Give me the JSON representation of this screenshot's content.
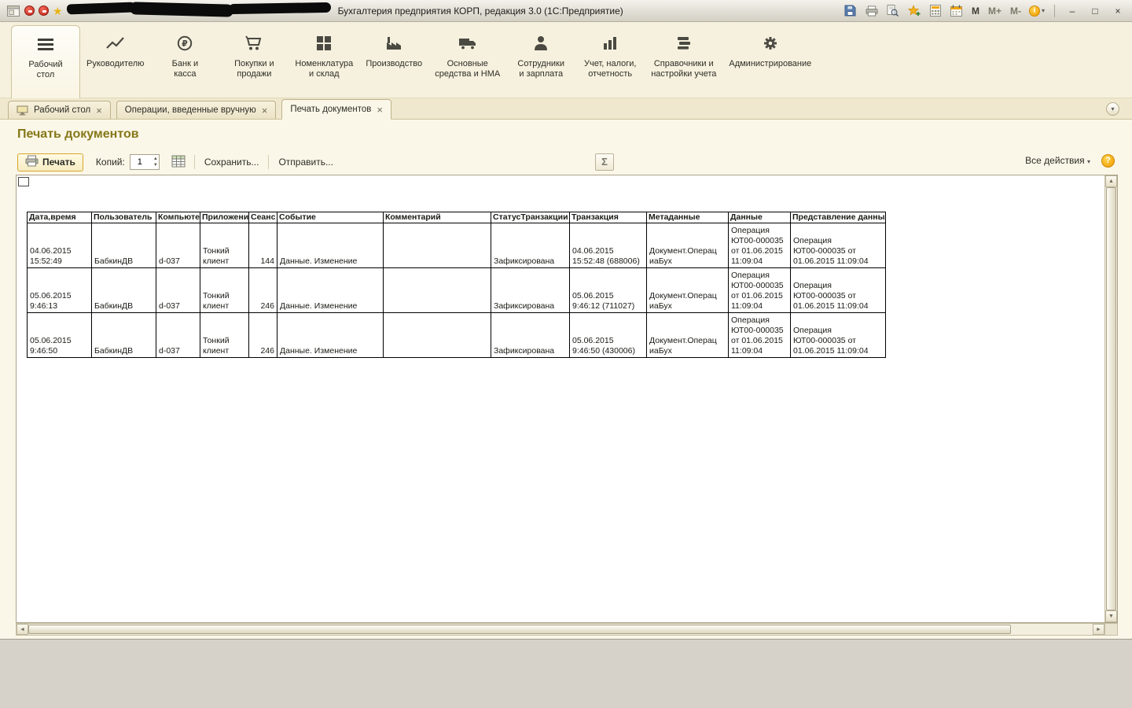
{
  "window": {
    "title": "Бухгалтерия предприятия КОРП, редакция 3.0  (1С:Предприятие)",
    "memory_buttons": [
      "M",
      "M+",
      "M-"
    ]
  },
  "ui": {
    "close_glyph": "×",
    "dropdown_glyph": "▾",
    "star_glyph": "★",
    "info_glyph": "i",
    "minimize_glyph": "–",
    "maximize_glyph": "□",
    "spin_up": "▲",
    "spin_down": "▼",
    "scroll_up": "▲",
    "scroll_down": "▼",
    "scroll_left": "◄",
    "scroll_right": "►"
  },
  "sections": [
    {
      "label": "Рабочий\nстол",
      "icon": "menu-icon",
      "active": true
    },
    {
      "label": "Руководителю",
      "icon": "trend-icon",
      "active": false
    },
    {
      "label": "Банк и\nкасса",
      "icon": "coin-icon",
      "active": false
    },
    {
      "label": "Покупки и\nпродажи",
      "icon": "cart-icon",
      "active": false
    },
    {
      "label": "Номенклатура\nи склад",
      "icon": "grid-icon",
      "active": false
    },
    {
      "label": "Производство",
      "icon": "factory-icon",
      "active": false
    },
    {
      "label": "Основные\nсредства и НМА",
      "icon": "truck-icon",
      "active": false
    },
    {
      "label": "Сотрудники\nи зарплата",
      "icon": "person-icon",
      "active": false
    },
    {
      "label": "Учет, налоги,\nотчетность",
      "icon": "barchart-icon",
      "active": false
    },
    {
      "label": "Справочники и\nнастройки учета",
      "icon": "books-icon",
      "active": false
    },
    {
      "label": "Администрирование",
      "icon": "gear-icon",
      "active": false
    }
  ],
  "tabs": [
    {
      "label": "Рабочий стол",
      "active": false
    },
    {
      "label": "Операции, введенные вручную",
      "active": false
    },
    {
      "label": "Печать документов",
      "active": true
    }
  ],
  "page": {
    "title": "Печать документов",
    "toolbar": {
      "print_label": "Печать",
      "copies_label": "Копий:",
      "copies_value": "1",
      "save_label": "Сохранить...",
      "send_label": "Отправить...",
      "sigma_label": "Σ",
      "all_actions_label": "Все действия",
      "help_label": "?"
    },
    "table": {
      "columns": [
        "Дата,время",
        "Пользователь",
        "Компьютер",
        "Приложение",
        "Сеанс",
        "Событие",
        "Комментарий",
        "СтатусТранзакции",
        "Транзакция",
        "Метаданные",
        "Данные",
        "Представление данных"
      ],
      "rows": [
        {
          "cells": [
            "04.06.2015\n15:52:49",
            "БабкинДВ",
            "d-037",
            "Тонкий\nклиент",
            "144",
            "Данные. Изменение",
            "",
            "Зафиксирована",
            "04.06.2015\n15:52:48 (688006)",
            "Документ.Операц\nиаБух",
            "Операция\nЮТ00-000035\nот 01.06.2015\n11:09:04",
            "Операция\nЮТ00-000035 от\n01.06.2015 11:09:04"
          ]
        },
        {
          "cells": [
            "05.06.2015\n9:46:13",
            "БабкинДВ",
            "d-037",
            "Тонкий\nклиент",
            "246",
            "Данные. Изменение",
            "",
            "Зафиксирована",
            "05.06.2015\n9:46:12 (711027)",
            "Документ.Операц\nиаБух",
            "Операция\nЮТ00-000035\nот 01.06.2015\n11:09:04",
            "Операция\nЮТ00-000035 от\n01.06.2015 11:09:04"
          ]
        },
        {
          "cells": [
            "05.06.2015\n9:46:50",
            "БабкинДВ",
            "d-037",
            "Тонкий\nклиент",
            "246",
            "Данные. Изменение",
            "",
            "Зафиксирована",
            "05.06.2015\n9:46:50 (430006)",
            "Документ.Операц\nиаБух",
            "Операция\nЮТ00-000035\nот 01.06.2015\n11:09:04",
            "Операция\nЮТ00-000035 от\n01.06.2015 11:09:04"
          ]
        }
      ]
    }
  },
  "colors": {
    "accent_gold": "#d9a52c",
    "title_olive": "#857718",
    "help_orange": "#ef9c00",
    "badge_red": "#c3271b"
  }
}
